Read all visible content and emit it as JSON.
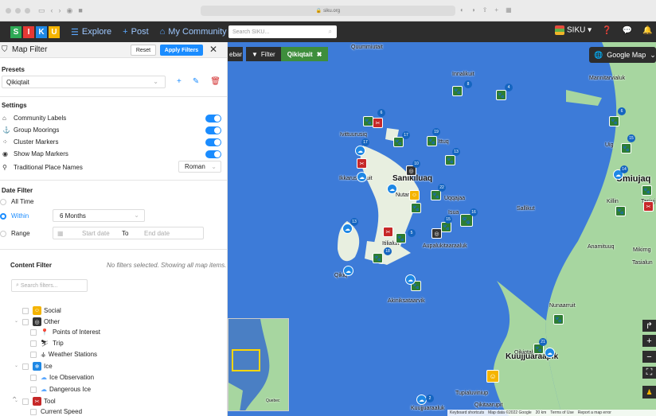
{
  "browser": {
    "url": "siku.org"
  },
  "appbar": {
    "logo_letters": [
      "S",
      "I",
      "K",
      "U"
    ],
    "logo_colors": [
      "#2eaa56",
      "#e53935",
      "#1e88e5",
      "#f5b400"
    ],
    "nav": [
      {
        "label": "Explore",
        "icon": "menu-icon"
      },
      {
        "label": "Post",
        "icon": "plus-icon"
      },
      {
        "label": "My Community",
        "icon": "community-icon"
      }
    ],
    "search_placeholder": "Search SIKU...",
    "user_label": "SIKU"
  },
  "panel": {
    "title": "Map Filter",
    "reset_label": "Reset",
    "apply_label": "Apply Filters",
    "presets": {
      "heading": "Presets",
      "selected": "Qikiqtait"
    },
    "settings": {
      "heading": "Settings",
      "rows": [
        {
          "label": "Community Labels",
          "icon": "community-icon",
          "on": true
        },
        {
          "label": "Group Moorings",
          "icon": "anchor-icon",
          "on": true
        },
        {
          "label": "Cluster Markers",
          "icon": "cluster-icon",
          "on": true
        },
        {
          "label": "Show Map Markers",
          "icon": "eye-icon",
          "on": true
        }
      ],
      "place_names_label": "Traditional Place Names",
      "place_names_value": "Roman"
    },
    "date_filter": {
      "heading": "Date Filter",
      "all_time": "All Time",
      "within": "Within",
      "within_value": "6 Months",
      "range": "Range",
      "start_placeholder": "Start date",
      "to": "To",
      "end_placeholder": "End date"
    },
    "content_filter": {
      "heading": "Content Filter",
      "note": "No filters selected. Showing all map items.",
      "search_placeholder": "Search filters...",
      "items": [
        {
          "label": "Social",
          "color": "#f5b400",
          "icon": "social-icon"
        },
        {
          "label": "Other",
          "color": "#333333",
          "icon": "other-icon"
        },
        {
          "label": "Points of Interest",
          "icon": "pin-icon"
        },
        {
          "label": "Trip",
          "icon": "sled-icon"
        },
        {
          "label": "Weather Stations",
          "icon": "weather-station-icon"
        },
        {
          "label": "Ice",
          "color": "#1e88e5",
          "icon": "ice-icon"
        },
        {
          "label": "Ice Observation",
          "icon": "ice-observation-icon"
        },
        {
          "label": "Dangerous Ice",
          "icon": "dangerous-ice-icon"
        },
        {
          "label": "Tool",
          "color": "#c62828",
          "icon": "tool-icon"
        },
        {
          "label": "Current Speed",
          "icon": ""
        }
      ]
    }
  },
  "map": {
    "sidebar_label": "ebar",
    "filter_label": "Filter",
    "filter_value": "Qikiqtait",
    "map_type": "Google Map",
    "places": [
      "Quummiutait",
      "Innalikuit",
      "Mannitarvialuk",
      "Ivittuurusiq",
      "Ittuq",
      "Uig",
      "Ikkarusraaluit",
      "Sanikiluaq",
      "Nutang",
      "Uqqajaa",
      "Sallikut",
      "Isua",
      "Killin",
      "Umiujaq",
      "Tasiuj",
      "Itilialuit",
      "Aupalukitaaraaluk",
      "Anamituuq",
      "Mikirng",
      "Tasialun",
      "Qikiq",
      "Akiniksataarvik",
      "Nunaarruit",
      "Qikiqtaluk",
      "Kuujjuaraapik",
      "Tupialuviniup",
      "Qikitaarupit",
      "Kuujjuaraaluk"
    ],
    "badge_counts": [
      "8",
      "4",
      "6",
      "17",
      "10",
      "19",
      "13",
      "16",
      "22",
      "15",
      "5",
      "18",
      "21",
      "8",
      "14",
      "2",
      "6"
    ],
    "attribution": [
      "Keyboard shortcuts",
      "Map data ©2022 Google",
      "20 km",
      "Terms of Use",
      "Report a map error"
    ],
    "minimap_label": "Quebec"
  }
}
